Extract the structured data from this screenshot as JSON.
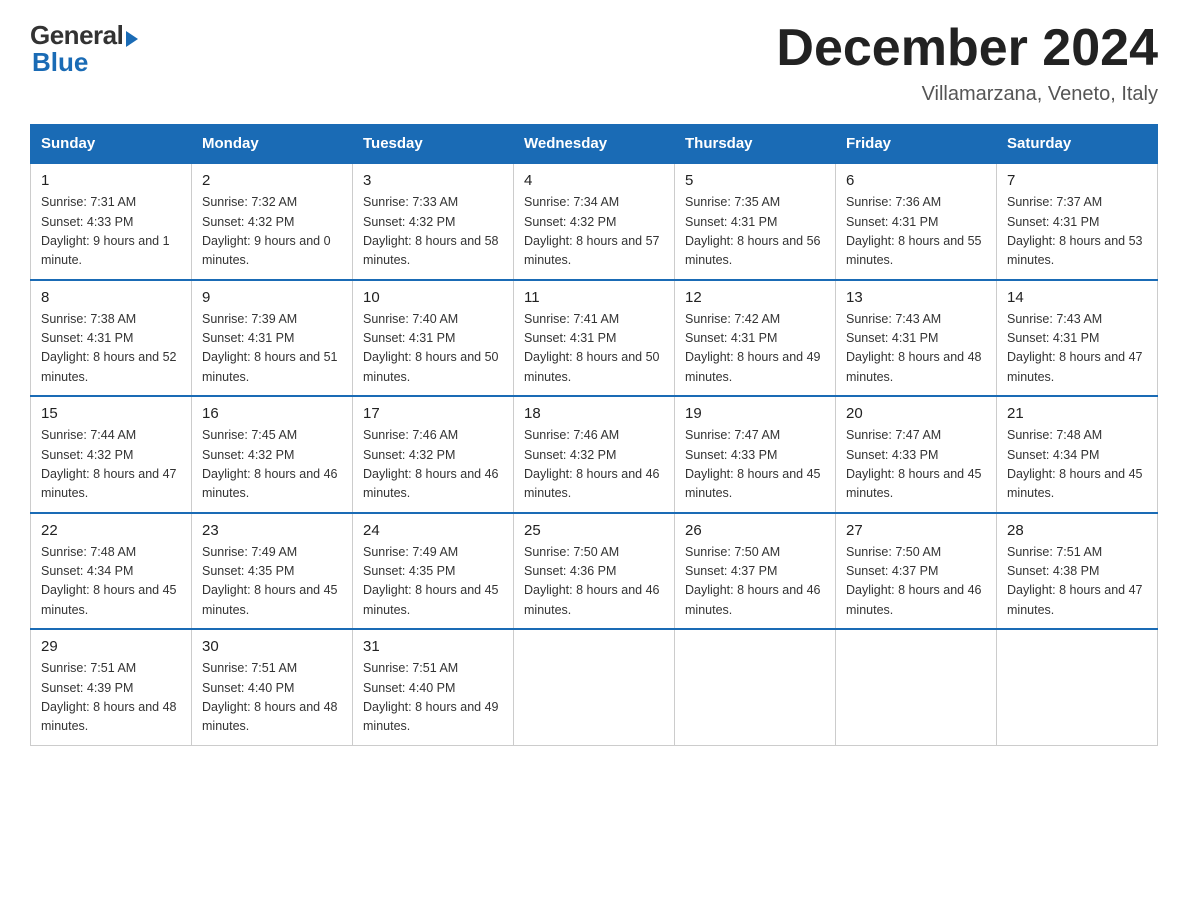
{
  "header": {
    "logo_general": "General",
    "logo_blue": "Blue",
    "month_title": "December 2024",
    "location": "Villamarzana, Veneto, Italy"
  },
  "days_of_week": [
    "Sunday",
    "Monday",
    "Tuesday",
    "Wednesday",
    "Thursday",
    "Friday",
    "Saturday"
  ],
  "weeks": [
    [
      {
        "day": "1",
        "sunrise": "7:31 AM",
        "sunset": "4:33 PM",
        "daylight": "9 hours and 1 minute."
      },
      {
        "day": "2",
        "sunrise": "7:32 AM",
        "sunset": "4:32 PM",
        "daylight": "9 hours and 0 minutes."
      },
      {
        "day": "3",
        "sunrise": "7:33 AM",
        "sunset": "4:32 PM",
        "daylight": "8 hours and 58 minutes."
      },
      {
        "day": "4",
        "sunrise": "7:34 AM",
        "sunset": "4:32 PM",
        "daylight": "8 hours and 57 minutes."
      },
      {
        "day": "5",
        "sunrise": "7:35 AM",
        "sunset": "4:31 PM",
        "daylight": "8 hours and 56 minutes."
      },
      {
        "day": "6",
        "sunrise": "7:36 AM",
        "sunset": "4:31 PM",
        "daylight": "8 hours and 55 minutes."
      },
      {
        "day": "7",
        "sunrise": "7:37 AM",
        "sunset": "4:31 PM",
        "daylight": "8 hours and 53 minutes."
      }
    ],
    [
      {
        "day": "8",
        "sunrise": "7:38 AM",
        "sunset": "4:31 PM",
        "daylight": "8 hours and 52 minutes."
      },
      {
        "day": "9",
        "sunrise": "7:39 AM",
        "sunset": "4:31 PM",
        "daylight": "8 hours and 51 minutes."
      },
      {
        "day": "10",
        "sunrise": "7:40 AM",
        "sunset": "4:31 PM",
        "daylight": "8 hours and 50 minutes."
      },
      {
        "day": "11",
        "sunrise": "7:41 AM",
        "sunset": "4:31 PM",
        "daylight": "8 hours and 50 minutes."
      },
      {
        "day": "12",
        "sunrise": "7:42 AM",
        "sunset": "4:31 PM",
        "daylight": "8 hours and 49 minutes."
      },
      {
        "day": "13",
        "sunrise": "7:43 AM",
        "sunset": "4:31 PM",
        "daylight": "8 hours and 48 minutes."
      },
      {
        "day": "14",
        "sunrise": "7:43 AM",
        "sunset": "4:31 PM",
        "daylight": "8 hours and 47 minutes."
      }
    ],
    [
      {
        "day": "15",
        "sunrise": "7:44 AM",
        "sunset": "4:32 PM",
        "daylight": "8 hours and 47 minutes."
      },
      {
        "day": "16",
        "sunrise": "7:45 AM",
        "sunset": "4:32 PM",
        "daylight": "8 hours and 46 minutes."
      },
      {
        "day": "17",
        "sunrise": "7:46 AM",
        "sunset": "4:32 PM",
        "daylight": "8 hours and 46 minutes."
      },
      {
        "day": "18",
        "sunrise": "7:46 AM",
        "sunset": "4:32 PM",
        "daylight": "8 hours and 46 minutes."
      },
      {
        "day": "19",
        "sunrise": "7:47 AM",
        "sunset": "4:33 PM",
        "daylight": "8 hours and 45 minutes."
      },
      {
        "day": "20",
        "sunrise": "7:47 AM",
        "sunset": "4:33 PM",
        "daylight": "8 hours and 45 minutes."
      },
      {
        "day": "21",
        "sunrise": "7:48 AM",
        "sunset": "4:34 PM",
        "daylight": "8 hours and 45 minutes."
      }
    ],
    [
      {
        "day": "22",
        "sunrise": "7:48 AM",
        "sunset": "4:34 PM",
        "daylight": "8 hours and 45 minutes."
      },
      {
        "day": "23",
        "sunrise": "7:49 AM",
        "sunset": "4:35 PM",
        "daylight": "8 hours and 45 minutes."
      },
      {
        "day": "24",
        "sunrise": "7:49 AM",
        "sunset": "4:35 PM",
        "daylight": "8 hours and 45 minutes."
      },
      {
        "day": "25",
        "sunrise": "7:50 AM",
        "sunset": "4:36 PM",
        "daylight": "8 hours and 46 minutes."
      },
      {
        "day": "26",
        "sunrise": "7:50 AM",
        "sunset": "4:37 PM",
        "daylight": "8 hours and 46 minutes."
      },
      {
        "day": "27",
        "sunrise": "7:50 AM",
        "sunset": "4:37 PM",
        "daylight": "8 hours and 46 minutes."
      },
      {
        "day": "28",
        "sunrise": "7:51 AM",
        "sunset": "4:38 PM",
        "daylight": "8 hours and 47 minutes."
      }
    ],
    [
      {
        "day": "29",
        "sunrise": "7:51 AM",
        "sunset": "4:39 PM",
        "daylight": "8 hours and 48 minutes."
      },
      {
        "day": "30",
        "sunrise": "7:51 AM",
        "sunset": "4:40 PM",
        "daylight": "8 hours and 48 minutes."
      },
      {
        "day": "31",
        "sunrise": "7:51 AM",
        "sunset": "4:40 PM",
        "daylight": "8 hours and 49 minutes."
      },
      null,
      null,
      null,
      null
    ]
  ]
}
